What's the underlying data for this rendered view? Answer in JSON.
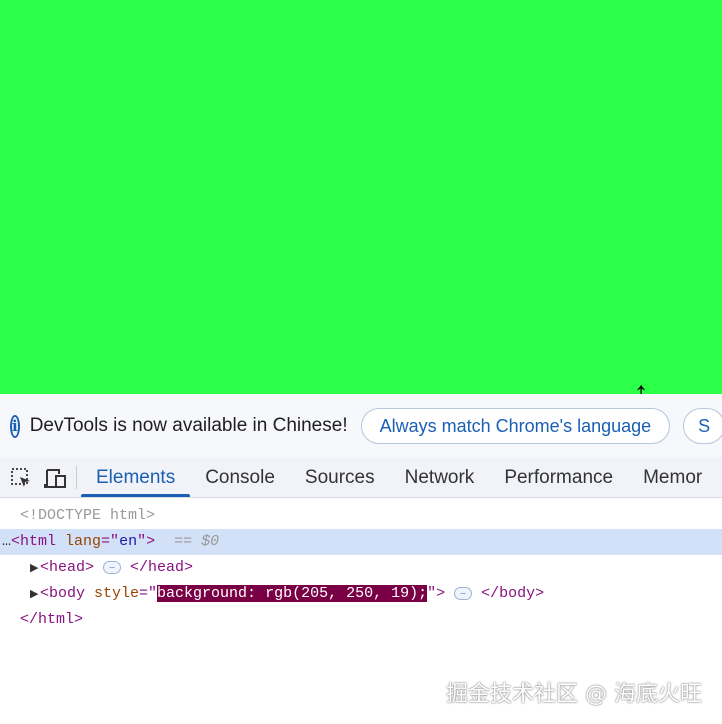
{
  "page": {
    "background_color": "#2cff48"
  },
  "infobar": {
    "message": "DevTools is now available in Chinese!",
    "button_match": "Always match Chrome's language",
    "button_partial": "S"
  },
  "tabs": [
    {
      "label": "Elements",
      "active": true
    },
    {
      "label": "Console"
    },
    {
      "label": "Sources"
    },
    {
      "label": "Network"
    },
    {
      "label": "Performance"
    },
    {
      "label": "Memor"
    }
  ],
  "tree": {
    "doctype": "<!DOCTYPE html>",
    "html_open": "<html",
    "html_attr": " lang",
    "html_eq": "=\"",
    "html_val": "en",
    "html_close": "\">",
    "selected_marker": "== $0",
    "head_open": "<head>",
    "head_close": "</head>",
    "body_open": "<body",
    "body_attr": " style",
    "body_eq": "=\"",
    "body_val": "background: rgb(205, 250, 19);",
    "body_q": "\">",
    "body_close": "</body>",
    "html_end": "</html>",
    "ellipsis": "…",
    "row_dots": "…"
  },
  "watermark": "掘金技术社区 @ 海底火旺"
}
